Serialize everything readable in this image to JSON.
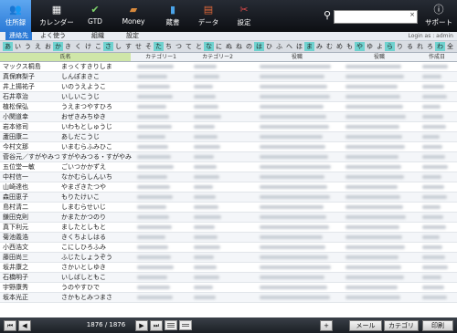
{
  "toolbar": {
    "items": [
      {
        "label": "住所録",
        "icon": "address-book-icon",
        "glyph": "👥"
      },
      {
        "label": "カレンダー",
        "icon": "calendar-icon",
        "glyph": "▦"
      },
      {
        "label": "GTD",
        "icon": "check-icon",
        "glyph": "✔"
      },
      {
        "label": "Money",
        "icon": "wallet-icon",
        "glyph": "▰"
      },
      {
        "label": "蔵書",
        "icon": "book-icon",
        "glyph": "▮"
      },
      {
        "label": "データ",
        "icon": "data-icon",
        "glyph": "▤"
      },
      {
        "label": "設定",
        "icon": "tools-icon",
        "glyph": "✂"
      }
    ],
    "support_label": "サポート",
    "support_glyph": "ⓘ",
    "search_value": "",
    "search_glyph": "⚲",
    "clear_glyph": "×"
  },
  "subbar": {
    "items": [
      "連絡先",
      "よく使う",
      "組織",
      "設定"
    ],
    "login": "Login as : admin"
  },
  "kana": [
    "あ",
    "い",
    "う",
    "え",
    "お",
    "か",
    "き",
    "く",
    "け",
    "こ",
    "さ",
    "し",
    "す",
    "せ",
    "そ",
    "た",
    "ち",
    "つ",
    "て",
    "と",
    "な",
    "に",
    "ぬ",
    "ね",
    "の",
    "は",
    "ひ",
    "ふ",
    "へ",
    "ほ",
    "ま",
    "み",
    "む",
    "め",
    "も",
    "や",
    "ゆ",
    "よ",
    "ら",
    "り",
    "る",
    "れ",
    "ろ",
    "わ",
    "全"
  ],
  "columns": {
    "name": "氏名",
    "kana": "",
    "cat1": "カテゴリー1",
    "cat2": "カテゴリー2",
    "title": "役職",
    "position": "役職",
    "created": "作成日"
  },
  "rows": [
    {
      "name": "マックス桐島",
      "kana": "まっくすきりしま"
    },
    {
      "name": "真保麻梨子",
      "kana": "しんぽまきこ"
    },
    {
      "name": "井上揚祐子",
      "kana": "いのうえようこ"
    },
    {
      "name": "石井章治",
      "kana": "いしいこうじ"
    },
    {
      "name": "植松保弘",
      "kana": "うえまつやすひろ"
    },
    {
      "name": "小関道幸",
      "kana": "おぜきみちゆき"
    },
    {
      "name": "岩本修司",
      "kana": "いわもとしゅうじ"
    },
    {
      "name": "蘆田康二",
      "kana": "あしだこうじ"
    },
    {
      "name": "今村文那",
      "kana": "いまむらふみひこ"
    },
    {
      "name": "菅谷元／すがやみつ",
      "kana": "すがやみつる・すがやみ"
    },
    {
      "name": "五位堂一敏",
      "kana": "ごいつかかずえ"
    },
    {
      "name": "中村信一",
      "kana": "なかむらしんいち"
    },
    {
      "name": "山崎達也",
      "kana": "やまざきたつや"
    },
    {
      "name": "森田恵子",
      "kana": "もりたけいこ"
    },
    {
      "name": "島村清二",
      "kana": "しまむらせいじ"
    },
    {
      "name": "鎌田克則",
      "kana": "かまたかつのり"
    },
    {
      "name": "真下利元",
      "kana": "ましたとしもと"
    },
    {
      "name": "菊池義浩",
      "kana": "きくちよしはる"
    },
    {
      "name": "小西浩文",
      "kana": "こにしひろふみ"
    },
    {
      "name": "藤田尚三",
      "kana": "ふじたしょうぞう"
    },
    {
      "name": "坂井康之",
      "kana": "さかいとしゆき"
    },
    {
      "name": "石橋明子",
      "kana": "いしばしともこ"
    },
    {
      "name": "宇野康秀",
      "kana": "うのやすひで"
    },
    {
      "name": "坂本光正",
      "kana": "さかもとみつまさ"
    }
  ],
  "footer": {
    "counter": "1876 / 1876",
    "add_glyph": "+",
    "mail_label": "メール",
    "category_label": "カテゴリ",
    "print_label": "印刷"
  }
}
